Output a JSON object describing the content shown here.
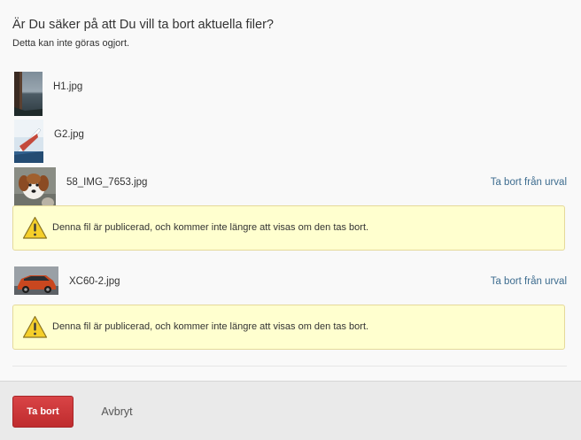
{
  "dialog": {
    "title": "Är Du säker på att Du vill ta bort aktuella filer?",
    "subtitle": "Detta kan inte göras ogjort."
  },
  "files": [
    {
      "name": "H1.jpg",
      "thumb_icon": "image-thumbnail-sea-landscape",
      "published": false
    },
    {
      "name": "G2.jpg",
      "thumb_icon": "image-thumbnail-sailboat",
      "published": false
    },
    {
      "name": "58_IMG_7653.jpg",
      "thumb_icon": "image-thumbnail-puppy",
      "published": true,
      "remove_label": "Ta bort från urval"
    },
    {
      "name": "XC60-2.jpg",
      "thumb_icon": "image-thumbnail-car",
      "published": true,
      "remove_label": "Ta bort från urval"
    }
  ],
  "warning": {
    "text": "Denna fil är publicerad, och kommer inte längre att visas om den tas bort.",
    "icon": "warning-triangle-icon"
  },
  "footer": {
    "delete_label": "Ta bort",
    "cancel_label": "Avbryt"
  },
  "colors": {
    "delete_button": "#c73234",
    "link": "#3d6c8f",
    "warning_bg": "#ffffcf",
    "warning_border": "#e5d99a"
  }
}
